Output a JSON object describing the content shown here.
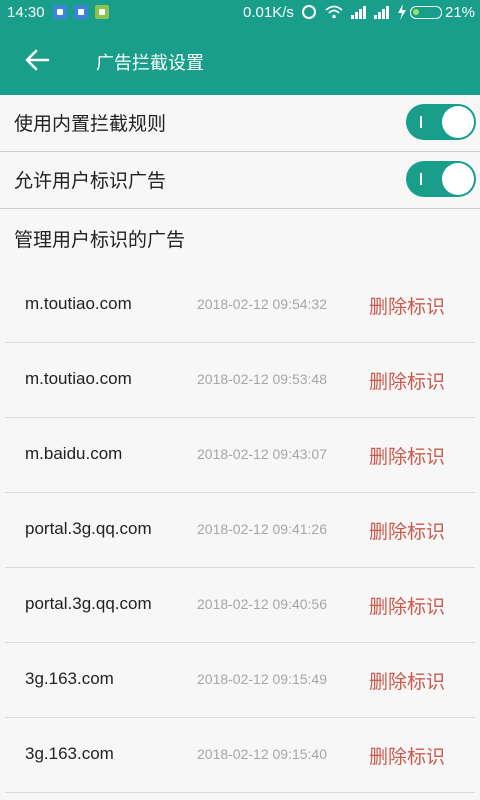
{
  "status_bar": {
    "time": "14:30",
    "net_speed": "0.01K/s",
    "battery_pct": "21%",
    "colors": {
      "bar_bg": "#189e8a",
      "battery_fill": "#9be15d"
    },
    "icons": [
      "usb-debug-icon",
      "notification-app-icon",
      "android-icon",
      "alarm-icon",
      "wifi-icon",
      "signal-icon",
      "signal-icon",
      "charging-icon",
      "battery-icon"
    ]
  },
  "app_bar": {
    "title": "广告拦截设置",
    "back_icon": "arrow-left-icon"
  },
  "settings": [
    {
      "label": "使用内置拦截规则",
      "enabled": true
    },
    {
      "label": "允许用户标识广告",
      "enabled": true
    }
  ],
  "section_title": "管理用户标识的广告",
  "ad_list": [
    {
      "domain": "m.toutiao.com",
      "time": "2018-02-12 09:54:32",
      "action": "删除标识"
    },
    {
      "domain": "m.toutiao.com",
      "time": "2018-02-12 09:53:48",
      "action": "删除标识"
    },
    {
      "domain": "m.baidu.com",
      "time": "2018-02-12 09:43:07",
      "action": "删除标识"
    },
    {
      "domain": "portal.3g.qq.com",
      "time": "2018-02-12 09:41:26",
      "action": "删除标识"
    },
    {
      "domain": "portal.3g.qq.com",
      "time": "2018-02-12 09:40:56",
      "action": "删除标识"
    },
    {
      "domain": "3g.163.com",
      "time": "2018-02-12 09:15:49",
      "action": "删除标识"
    },
    {
      "domain": "3g.163.com",
      "time": "2018-02-12 09:15:40",
      "action": "删除标识"
    }
  ],
  "colors": {
    "accent": "#189e8a",
    "delete_text": "#cb5a4d",
    "timestamp_text": "#a6a6a6"
  }
}
